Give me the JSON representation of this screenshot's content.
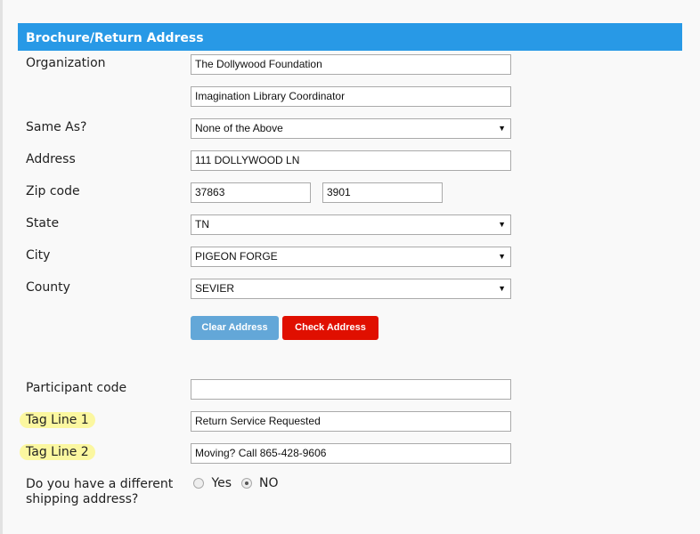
{
  "section_title": "Brochure/Return Address",
  "labels": {
    "organization": "Organization",
    "same_as": "Same As?",
    "address": "Address",
    "zip": "Zip code",
    "state": "State",
    "city": "City",
    "county": "County",
    "participant": "Participant code",
    "tag1": "Tag Line 1",
    "tag2": "Tag Line 2",
    "shipping_q1": "Do you have a different",
    "shipping_q2": "shipping address?"
  },
  "values": {
    "org1": "The Dollywood Foundation",
    "org2": "Imagination Library Coordinator",
    "same_as": "None of the Above",
    "address": "111 DOLLYWOOD LN",
    "zip5": "37863",
    "zip4": "3901",
    "state": "TN",
    "city": "PIGEON FORGE",
    "county": "SEVIER",
    "participant": "",
    "tag1": "Return Service Requested",
    "tag2": "Moving?  Call 865-428-9606"
  },
  "buttons": {
    "clear": "Clear Address",
    "check": "Check Address"
  },
  "radio": {
    "yes": "Yes",
    "no": "NO",
    "selected": "NO"
  },
  "arrow": "▼"
}
